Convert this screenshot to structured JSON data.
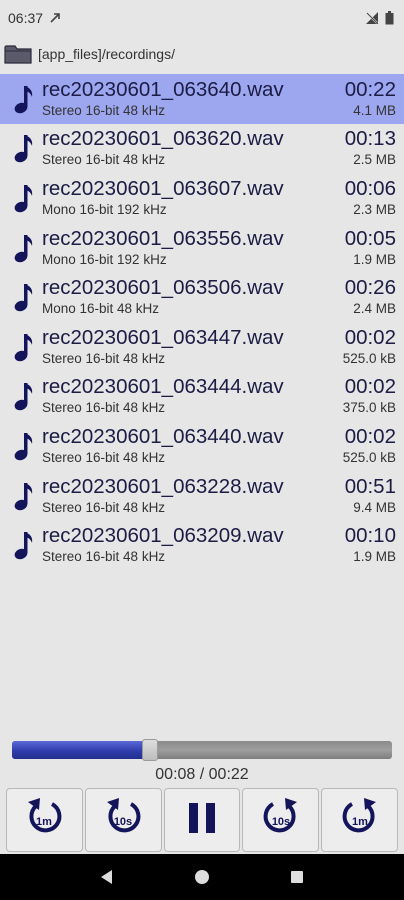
{
  "status_bar": {
    "time": "06:37",
    "left_icon": "signal-arrow-icon",
    "right_icons": [
      "no-signal-icon",
      "battery-icon"
    ]
  },
  "path_bar": {
    "icon": "folder-icon",
    "path": "[app_files]/recordings/"
  },
  "recordings": [
    {
      "name": "rec20230601_063640.wav",
      "format": "Stereo 16-bit 48 kHz",
      "duration": "00:22",
      "size": "4.1 MB",
      "selected": true
    },
    {
      "name": "rec20230601_063620.wav",
      "format": "Stereo 16-bit 48 kHz",
      "duration": "00:13",
      "size": "2.5 MB",
      "selected": false
    },
    {
      "name": "rec20230601_063607.wav",
      "format": "Mono 16-bit 192 kHz",
      "duration": "00:06",
      "size": "2.3 MB",
      "selected": false
    },
    {
      "name": "rec20230601_063556.wav",
      "format": "Mono 16-bit 192 kHz",
      "duration": "00:05",
      "size": "1.9 MB",
      "selected": false
    },
    {
      "name": "rec20230601_063506.wav",
      "format": "Mono 16-bit 48 kHz",
      "duration": "00:26",
      "size": "2.4 MB",
      "selected": false
    },
    {
      "name": "rec20230601_063447.wav",
      "format": "Stereo 16-bit 48 kHz",
      "duration": "00:02",
      "size": "525.0 kB",
      "selected": false
    },
    {
      "name": "rec20230601_063444.wav",
      "format": "Stereo 16-bit 48 kHz",
      "duration": "00:02",
      "size": "375.0 kB",
      "selected": false
    },
    {
      "name": "rec20230601_063440.wav",
      "format": "Stereo 16-bit 48 kHz",
      "duration": "00:02",
      "size": "525.0 kB",
      "selected": false
    },
    {
      "name": "rec20230601_063228.wav",
      "format": "Stereo 16-bit 48 kHz",
      "duration": "00:51",
      "size": "9.4 MB",
      "selected": false
    },
    {
      "name": "rec20230601_063209.wav",
      "format": "Stereo 16-bit 48 kHz",
      "duration": "00:10",
      "size": "1.9 MB",
      "selected": false
    }
  ],
  "player": {
    "progress_fraction": 0.3636,
    "time_display": "00:08 / 00:22",
    "buttons": [
      {
        "name": "rewind-1m-button",
        "icon": "rewind-icon",
        "label": "1m"
      },
      {
        "name": "rewind-10s-button",
        "icon": "rewind-icon",
        "label": "10s"
      },
      {
        "name": "pause-button",
        "icon": "pause-icon",
        "label": ""
      },
      {
        "name": "forward-10s-button",
        "icon": "forward-icon",
        "label": "10s"
      },
      {
        "name": "forward-1m-button",
        "icon": "forward-icon",
        "label": "1m"
      }
    ]
  },
  "nav_bar": {
    "back": "back-triangle-icon",
    "home": "home-circle-icon",
    "recents": "recents-square-icon"
  },
  "colors": {
    "background": "#e6e6e6",
    "selected_row": "#9ca7ef",
    "progress_fill": "#2f3dab",
    "progress_track": "#8e8e8e",
    "icon_navy": "#14145a"
  }
}
